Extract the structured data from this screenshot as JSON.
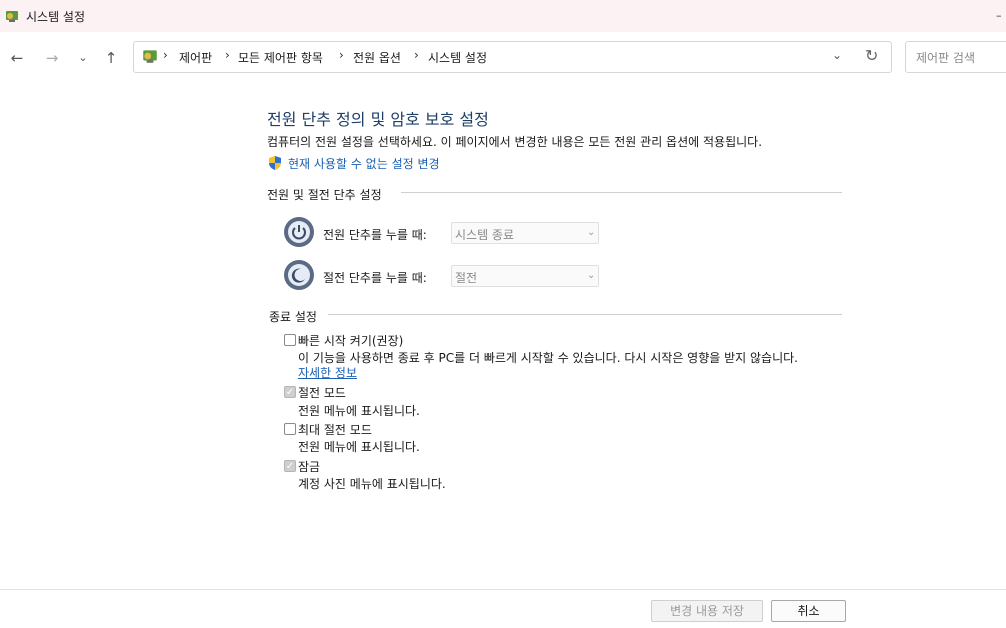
{
  "window": {
    "title": "시스템 설정"
  },
  "nav": {
    "back_icon": "arrow-left-icon",
    "forward_icon": "arrow-right-icon",
    "recent_icon": "chevron-down-icon",
    "up_icon": "arrow-up-icon",
    "breadcrumbs": [
      "제어판",
      "모든 제어판 항목",
      "전원 옵션",
      "시스템 설정"
    ],
    "search_placeholder": "제어판 검색"
  },
  "main": {
    "heading": "전원 단추 정의 및 암호 보호 설정",
    "description": "컴퓨터의 전원 설정을 선택하세요. 이 페이지에서 변경한 내용은 모든 전원 관리 옵션에 적용됩니다.",
    "change_link": "현재 사용할 수 없는 설정 변경",
    "power_section": {
      "title": "전원 및 절전 단추 설정",
      "rows": [
        {
          "label": "전원 단추를 누를 때:",
          "value": "시스템 종료",
          "icon": "power-icon"
        },
        {
          "label": "절전 단추를 누를 때:",
          "value": "절전",
          "icon": "moon-icon"
        }
      ]
    },
    "shutdown_section": {
      "title": "종료 설정",
      "items": [
        {
          "label": "빠른 시작 켜기(권장)",
          "checked": false,
          "description": "이 기능을 사용하면 종료 후 PC를 더 빠르게 시작할 수 있습니다. 다시 시작은 영향을 받지 않습니다.",
          "link": "자세한 정보"
        },
        {
          "label": "절전 모드",
          "checked": true,
          "description": "전원 메뉴에 표시됩니다."
        },
        {
          "label": "최대 절전 모드",
          "checked": false,
          "description": "전원 메뉴에 표시됩니다."
        },
        {
          "label": "잠금",
          "checked": true,
          "description": "계정 사진 메뉴에 표시됩니다."
        }
      ]
    }
  },
  "footer": {
    "save_label": "변경 내용 저장",
    "cancel_label": "취소"
  },
  "colors": {
    "heading": "#1e3f66",
    "link": "#1a5fb4",
    "titlebar": "#fcf1f3"
  }
}
